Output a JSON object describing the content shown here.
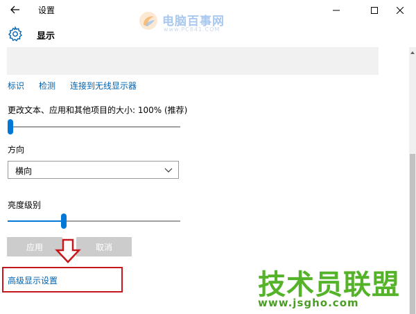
{
  "window": {
    "title": "设置"
  },
  "header": {
    "page_title": "显示"
  },
  "display": {
    "links": {
      "identify": "标识",
      "detect": "检测",
      "wireless": "连接到无线显示器"
    },
    "scale": {
      "label": "更改文本、应用和其他项目的大小: 100% (推荐)",
      "level": 0
    },
    "orientation": {
      "label": "方向",
      "selected": "横向"
    },
    "brightness": {
      "label": "亮度级别",
      "level": 0.32
    },
    "buttons": {
      "apply": "应用",
      "cancel": "取消"
    },
    "advanced_link": "高级显示设置"
  },
  "watermarks": {
    "top_name": "电脑百事网",
    "top_url": "www.PC841.COM",
    "bottom_name": "技术员联盟",
    "bottom_url": "www.jsgho.com"
  },
  "colors": {
    "accent": "#0078d7",
    "link": "#0063b1",
    "annotation_red": "#c8161d",
    "watermark_green": "#55b32a"
  },
  "icons": {
    "back": "back-arrow-icon",
    "settings": "gear-icon",
    "minimize": "minimize-icon",
    "maximize": "maximize-icon",
    "close": "close-icon",
    "dropdown": "chevron-down-icon",
    "annotation": "red-down-arrow-icon"
  }
}
